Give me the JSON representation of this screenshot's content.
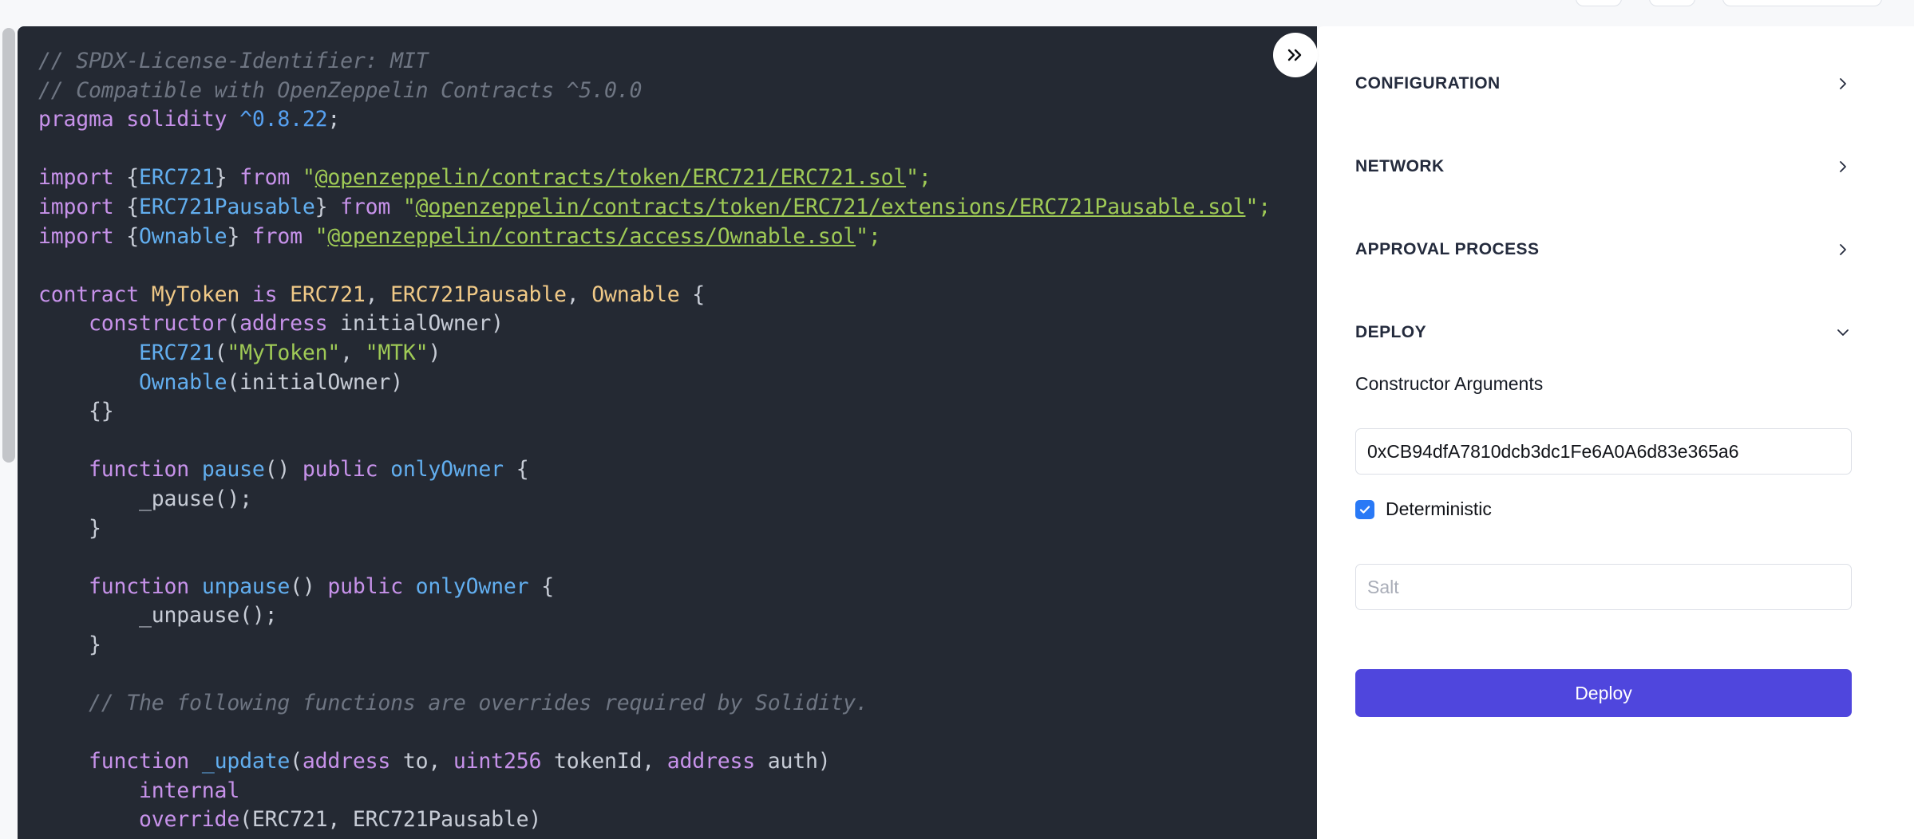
{
  "top_toolbar": {
    "buttons": [
      {
        "name": "toolbar-button-1",
        "label": ""
      },
      {
        "name": "toolbar-button-2",
        "label": ""
      },
      {
        "name": "toolbar-button-3",
        "label": ""
      }
    ]
  },
  "editor": {
    "language": "solidity",
    "collapse_button_glyph": "»",
    "theme_background": "#242933",
    "lines": [
      [
        {
          "t": "// SPDX-License-Identifier: MIT",
          "c": "t-com"
        }
      ],
      [
        {
          "t": "// Compatible with OpenZeppelin Contracts ^5.0.0",
          "c": "t-com"
        }
      ],
      [
        {
          "t": "pragma solidity ",
          "c": "t-kw"
        },
        {
          "t": "^0.8.22",
          "c": "t-num"
        },
        {
          "t": ";",
          "c": "t-pun"
        }
      ],
      [
        {
          "t": "",
          "c": "t-pun"
        }
      ],
      [
        {
          "t": "import ",
          "c": "t-kw"
        },
        {
          "t": "{",
          "c": "t-pun"
        },
        {
          "t": "ERC721",
          "c": "t-id"
        },
        {
          "t": "} ",
          "c": "t-pun"
        },
        {
          "t": "from ",
          "c": "t-kw"
        },
        {
          "t": "\"",
          "c": "t-strp"
        },
        {
          "t": "@openzeppelin/contracts/token/ERC721/ERC721.sol",
          "c": "t-str"
        },
        {
          "t": "\";",
          "c": "t-strp"
        }
      ],
      [
        {
          "t": "import ",
          "c": "t-kw"
        },
        {
          "t": "{",
          "c": "t-pun"
        },
        {
          "t": "ERC721Pausable",
          "c": "t-id"
        },
        {
          "t": "} ",
          "c": "t-pun"
        },
        {
          "t": "from ",
          "c": "t-kw"
        },
        {
          "t": "\"",
          "c": "t-strp"
        },
        {
          "t": "@openzeppelin/contracts/token/ERC721/extensions/ERC721Pausable.sol",
          "c": "t-str"
        },
        {
          "t": "\";",
          "c": "t-strp"
        }
      ],
      [
        {
          "t": "import ",
          "c": "t-kw"
        },
        {
          "t": "{",
          "c": "t-pun"
        },
        {
          "t": "Ownable",
          "c": "t-id"
        },
        {
          "t": "} ",
          "c": "t-pun"
        },
        {
          "t": "from ",
          "c": "t-kw"
        },
        {
          "t": "\"",
          "c": "t-strp"
        },
        {
          "t": "@openzeppelin/contracts/access/Ownable.sol",
          "c": "t-str"
        },
        {
          "t": "\";",
          "c": "t-strp"
        }
      ],
      [
        {
          "t": "",
          "c": "t-pun"
        }
      ],
      [
        {
          "t": "contract ",
          "c": "t-kw"
        },
        {
          "t": "MyToken ",
          "c": "t-typ"
        },
        {
          "t": "is ",
          "c": "t-kw"
        },
        {
          "t": "ERC721",
          "c": "t-typ"
        },
        {
          "t": ", ",
          "c": "t-pun"
        },
        {
          "t": "ERC721Pausable",
          "c": "t-typ"
        },
        {
          "t": ", ",
          "c": "t-pun"
        },
        {
          "t": "Ownable ",
          "c": "t-typ"
        },
        {
          "t": "{",
          "c": "t-pun"
        }
      ],
      [
        {
          "t": "    constructor",
          "c": "t-kw"
        },
        {
          "t": "(",
          "c": "t-pun"
        },
        {
          "t": "address",
          "c": "t-kw"
        },
        {
          "t": " initialOwner)",
          "c": "t-var"
        }
      ],
      [
        {
          "t": "        ",
          "c": "t-pun"
        },
        {
          "t": "ERC721",
          "c": "t-fn"
        },
        {
          "t": "(",
          "c": "t-pun"
        },
        {
          "t": "\"MyToken\"",
          "c": "t-strp"
        },
        {
          "t": ", ",
          "c": "t-pun"
        },
        {
          "t": "\"MTK\"",
          "c": "t-strp"
        },
        {
          "t": ")",
          "c": "t-pun"
        }
      ],
      [
        {
          "t": "        ",
          "c": "t-pun"
        },
        {
          "t": "Ownable",
          "c": "t-fn"
        },
        {
          "t": "(initialOwner)",
          "c": "t-var"
        }
      ],
      [
        {
          "t": "    {}",
          "c": "t-pun"
        }
      ],
      [
        {
          "t": "",
          "c": "t-pun"
        }
      ],
      [
        {
          "t": "    function ",
          "c": "t-kw"
        },
        {
          "t": "pause",
          "c": "t-fn"
        },
        {
          "t": "() ",
          "c": "t-pun"
        },
        {
          "t": "public ",
          "c": "t-kw"
        },
        {
          "t": "onlyOwner ",
          "c": "t-fn"
        },
        {
          "t": "{",
          "c": "t-pun"
        }
      ],
      [
        {
          "t": "        _pause();",
          "c": "t-var"
        }
      ],
      [
        {
          "t": "    }",
          "c": "t-pun"
        }
      ],
      [
        {
          "t": "",
          "c": "t-pun"
        }
      ],
      [
        {
          "t": "    function ",
          "c": "t-kw"
        },
        {
          "t": "unpause",
          "c": "t-fn"
        },
        {
          "t": "() ",
          "c": "t-pun"
        },
        {
          "t": "public ",
          "c": "t-kw"
        },
        {
          "t": "onlyOwner ",
          "c": "t-fn"
        },
        {
          "t": "{",
          "c": "t-pun"
        }
      ],
      [
        {
          "t": "        _unpause();",
          "c": "t-var"
        }
      ],
      [
        {
          "t": "    }",
          "c": "t-pun"
        }
      ],
      [
        {
          "t": "",
          "c": "t-pun"
        }
      ],
      [
        {
          "t": "    // The following functions are overrides required by Solidity.",
          "c": "t-com"
        }
      ],
      [
        {
          "t": "",
          "c": "t-pun"
        }
      ],
      [
        {
          "t": "    function ",
          "c": "t-kw"
        },
        {
          "t": "_update",
          "c": "t-fn"
        },
        {
          "t": "(",
          "c": "t-pun"
        },
        {
          "t": "address",
          "c": "t-kw"
        },
        {
          "t": " to, ",
          "c": "t-var"
        },
        {
          "t": "uint256",
          "c": "t-kw"
        },
        {
          "t": " tokenId, ",
          "c": "t-var"
        },
        {
          "t": "address",
          "c": "t-kw"
        },
        {
          "t": " auth)",
          "c": "t-var"
        }
      ],
      [
        {
          "t": "        internal",
          "c": "t-kw"
        }
      ],
      [
        {
          "t": "        override",
          "c": "t-kw"
        },
        {
          "t": "(ERC721, ERC721Pausable)",
          "c": "t-var"
        }
      ]
    ]
  },
  "panel": {
    "sections": [
      {
        "id": "configuration",
        "label": "CONFIGURATION",
        "expanded": false,
        "chevron": "chevron-right-icon"
      },
      {
        "id": "network",
        "label": "NETWORK",
        "expanded": false,
        "chevron": "chevron-right-icon"
      },
      {
        "id": "approval-process",
        "label": "APPROVAL PROCESS",
        "expanded": false,
        "chevron": "chevron-right-icon"
      },
      {
        "id": "deploy",
        "label": "DEPLOY",
        "expanded": true,
        "chevron": "chevron-down-icon"
      }
    ],
    "deploy": {
      "constructor_arguments_label": "Constructor Arguments",
      "constructor_arguments_value": "0xCB94dfA7810dcb3dc1Fe6A0A6d83e365a6",
      "constructor_arguments_placeholder": "",
      "deterministic_label": "Deterministic",
      "deterministic_checked": true,
      "salt_value": "",
      "salt_placeholder": "Salt",
      "deploy_button_label": "Deploy"
    }
  },
  "colors": {
    "accent_deploy": "#4f46dd",
    "checkbox_blue": "#2979f6",
    "editor_bg": "#242933",
    "page_bg": "#f7f8fa",
    "panel_bg": "#ffffff"
  }
}
